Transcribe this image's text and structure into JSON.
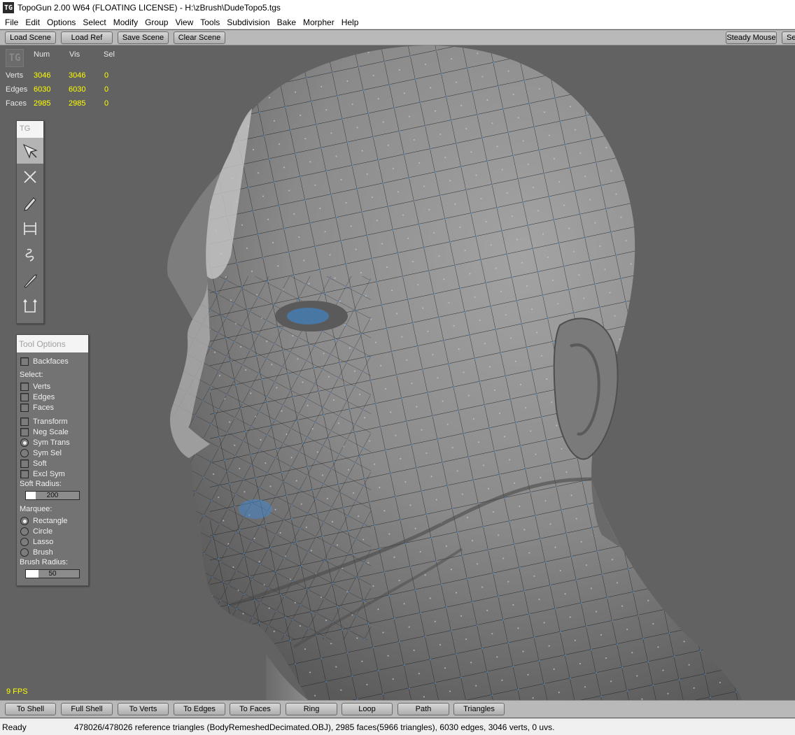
{
  "window": {
    "logo_glyph": "TG",
    "title": "TopoGun 2.00 W64  (FLOATING LICENSE)  - H:\\zBrush\\DudeTopo5.tgs"
  },
  "menu": [
    "File",
    "Edit",
    "Options",
    "Select",
    "Modify",
    "Group",
    "View",
    "Tools",
    "Subdivision",
    "Bake",
    "Morpher",
    "Help"
  ],
  "top_toolbar": {
    "load_scene": "Load Scene",
    "load_ref": "Load Ref",
    "save_scene": "Save Scene",
    "clear_scene": "Clear Scene",
    "steady_mouse": "Steady Mouse",
    "settings_partial": "Se"
  },
  "stats": {
    "logo_glyph": "TG",
    "headers": [
      "Num",
      "Vis",
      "Sel"
    ],
    "rows": [
      {
        "label": "Verts",
        "num": "3046",
        "vis": "3046",
        "sel": "0"
      },
      {
        "label": "Edges",
        "num": "6030",
        "vis": "6030",
        "sel": "0"
      },
      {
        "label": "Faces",
        "num": "2985",
        "vis": "2985",
        "sel": "0"
      }
    ]
  },
  "tool_palette": {
    "title": "TG",
    "tools": [
      "select-tool-icon",
      "delete-tool-icon",
      "draw-tool-icon",
      "bridge-tool-icon",
      "brush-tool-icon",
      "knife-tool-icon",
      "extrude-tool-icon"
    ],
    "active_index": 0
  },
  "tool_options": {
    "title": "Tool Options",
    "backfaces": {
      "label": "Backfaces",
      "checked": false
    },
    "select_label": "Select:",
    "select_verts": {
      "label": "Verts",
      "checked": false
    },
    "select_edges": {
      "label": "Edges",
      "checked": false
    },
    "select_faces": {
      "label": "Faces",
      "checked": false
    },
    "transform": {
      "label": "Transform",
      "checked": false
    },
    "neg_scale": {
      "label": "Neg Scale",
      "checked": false
    },
    "sym_trans": {
      "label": "Sym Trans",
      "selected": true
    },
    "sym_sel": {
      "label": "Sym Sel",
      "selected": false
    },
    "soft": {
      "label": "Soft",
      "checked": false
    },
    "excl_sym": {
      "label": "Excl Sym",
      "checked": false
    },
    "soft_radius_label": "Soft Radius:",
    "soft_radius_value": "200",
    "marquee_label": "Marquee:",
    "marquee_rectangle": {
      "label": "Rectangle",
      "selected": true
    },
    "marquee_circle": {
      "label": "Circle",
      "selected": false
    },
    "marquee_lasso": {
      "label": "Lasso",
      "selected": false
    },
    "marquee_brush": {
      "label": "Brush",
      "selected": false
    },
    "brush_radius_label": "Brush Radius:",
    "brush_radius_value": "50"
  },
  "fps": "9 FPS",
  "bottom_toolbar": {
    "to_shell": "To Shell",
    "full_shell": "Full Shell",
    "to_verts": "To Verts",
    "to_edges": "To Edges",
    "to_faces": "To Faces",
    "ring": "Ring",
    "loop": "Loop",
    "path": "Path",
    "triangles": "Triangles"
  },
  "status": {
    "state": "Ready",
    "message": "478026/478026 reference triangles (BodyRemeshedDecimated.OBJ), 2985 faces(5966 triangles), 6030 edges, 3046 verts, 0 uvs."
  },
  "colors": {
    "viewport_bg": "#626262",
    "mesh_vertex": "#3d8fe0",
    "mesh_edge": "#1a1a1a",
    "stats_value": "#ffff00",
    "head_base": "#8e8e8e"
  }
}
